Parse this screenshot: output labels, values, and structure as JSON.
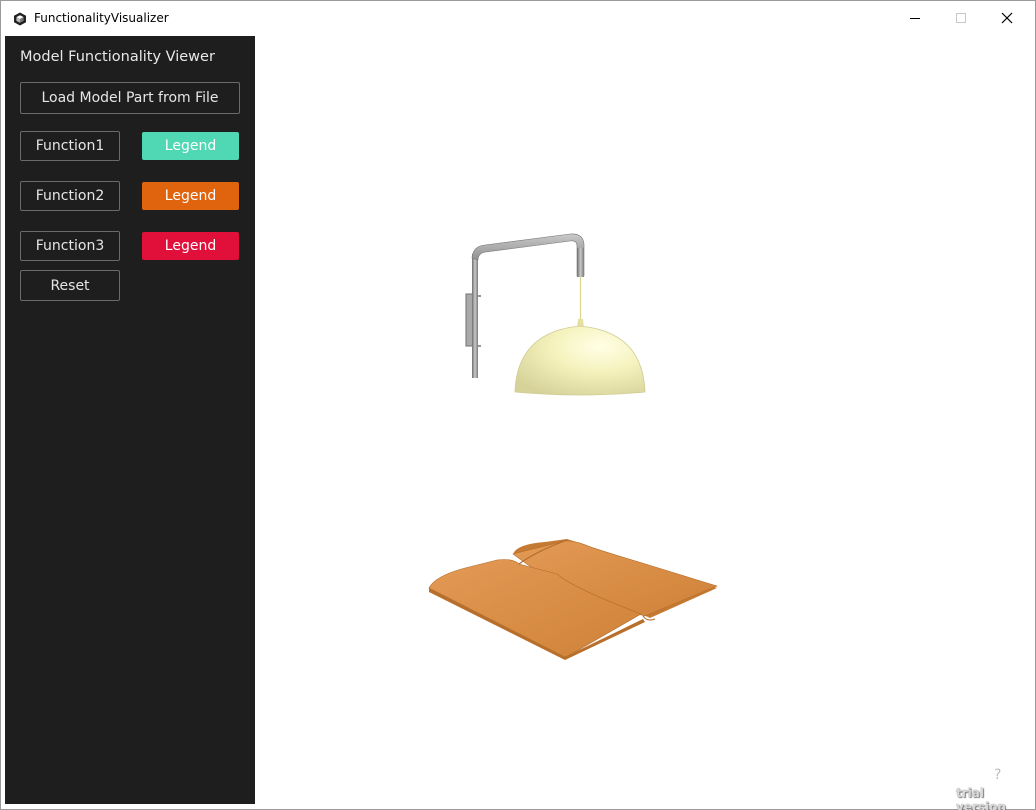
{
  "window": {
    "title": "FunctionalityVisualizer"
  },
  "sidebar": {
    "title": "Model Functionality Viewer",
    "load_label": "Load Model Part from File",
    "functions": [
      {
        "label": "Function1",
        "legend_label": "Legend",
        "legend_color": "#4fd8b3"
      },
      {
        "label": "Function2",
        "legend_label": "Legend",
        "legend_color": "#e0630d"
      },
      {
        "label": "Function3",
        "legend_label": "Legend",
        "legend_color": "#e0103b"
      }
    ],
    "reset_label": "Reset"
  },
  "viewport": {
    "help_mark": "?",
    "watermark": "trial version"
  },
  "colors": {
    "sidebar_bg": "#1e1e1e",
    "lamp_shade": "#f3f0b4",
    "lamp_arm": "#9a9a9a",
    "book": "#d98c42"
  }
}
